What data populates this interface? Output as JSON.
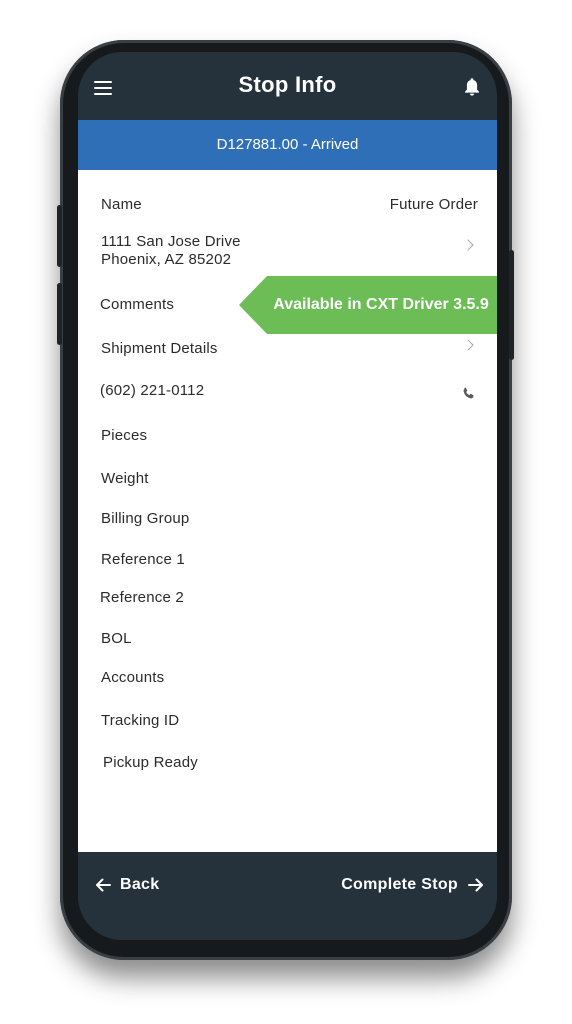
{
  "header": {
    "title": "Stop Info",
    "menu_icon": "hamburger-menu-icon",
    "bell_icon": "bell-icon"
  },
  "status": {
    "text": "D127881.00 - Arrived",
    "color": "#2e6fb7"
  },
  "details": {
    "name_label": "Name",
    "order_type": "Future Order",
    "address_line1": "1111 San Jose Drive",
    "address_line2": "Phoenix, AZ 85202",
    "comments_label": "Comments",
    "shipment_details_label": "Shipment Details",
    "phone": "(602) 221-0112",
    "pieces_label": "Pieces",
    "weight_label": "Weight",
    "billing_group_label": "Billing Group",
    "reference1_label": "Reference 1",
    "reference2_label": "Reference 2",
    "bol_label": "BOL",
    "accounts_label": "Accounts",
    "tracking_id_label": "Tracking ID",
    "pickup_ready_label": "Pickup Ready"
  },
  "callout": {
    "text": "Available in CXT Driver 3.5.9",
    "color": "#6cbd56"
  },
  "footer": {
    "back_label": "Back",
    "complete_label": "Complete Stop"
  }
}
